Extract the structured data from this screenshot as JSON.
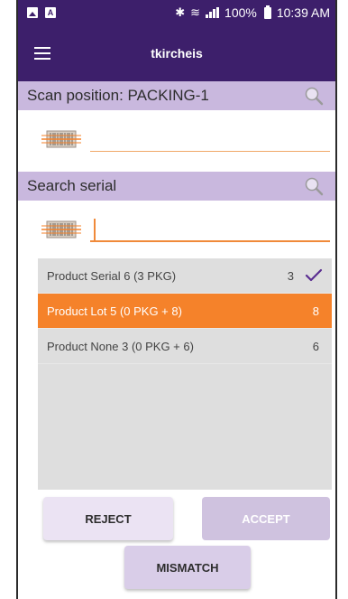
{
  "status_bar": {
    "bluetooth_glyph": "✱",
    "wifi_glyph": "≋",
    "battery_percent": "100%",
    "time": "10:39 AM"
  },
  "app_bar": {
    "title": "tkircheis"
  },
  "scan_position": {
    "label": "Scan position: PACKING-1",
    "value": ""
  },
  "search_serial": {
    "label": "Search serial",
    "value": ""
  },
  "items": [
    {
      "name": "Product Serial 6 (3 PKG)",
      "count": "3",
      "checked": true,
      "selected": false
    },
    {
      "name": "Product Lot 5 (0 PKG + 8)",
      "count": "8",
      "checked": false,
      "selected": true
    },
    {
      "name": "Product None 3 (0 PKG + 6)",
      "count": "6",
      "checked": false,
      "selected": false
    }
  ],
  "buttons": {
    "reject": "REJECT",
    "accept": "ACCEPT",
    "mismatch": "MISMATCH"
  },
  "colors": {
    "primary": "#3d1f6b",
    "header_bg": "#c9b8de",
    "accent": "#f5822a",
    "check": "#5a2d91"
  },
  "icons": [
    "image-icon",
    "notification-icon",
    "bluetooth-icon",
    "wifi-icon",
    "signal-icon",
    "battery-icon",
    "menu-icon",
    "search-icon",
    "barcode-scanner-icon",
    "checkmark-icon"
  ]
}
